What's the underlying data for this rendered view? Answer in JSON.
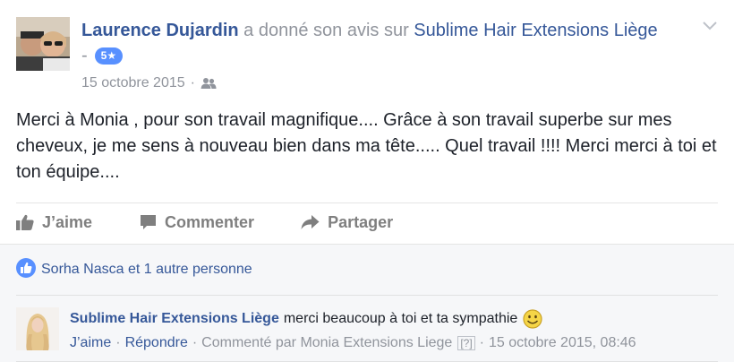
{
  "post": {
    "author": "Laurence Dujardin",
    "verb": "a donné son avis sur",
    "page": "Sublime Hair Extensions Liège",
    "dash": "-",
    "rating_badge": "5★",
    "date": "15 octobre 2015",
    "date_separator": "·",
    "audience_icon": "friends-icon",
    "text": "Merci à Monia , pour son travail magnifique.... Grâce à son travail superbe sur mes cheveux, je me sens à nouveau bien dans ma tête..... Quel travail !!!! Merci merci à toi et ton équipe...."
  },
  "actions": {
    "like": "J’aime",
    "comment": "Commenter",
    "share": "Partager"
  },
  "likes_summary": "Sorha Nasca et 1 autre personne",
  "comment": {
    "author": "Sublime Hair Extensions Liège",
    "text": "merci beaucoup à toi et ta sympathie",
    "like_link": "J’aime",
    "reply_link": "Répondre",
    "commented_by": "Commenté par Monia Extensions Liege",
    "help": "[?]",
    "timestamp": "15 octobre 2015, 08:46",
    "separator": "·"
  },
  "colors": {
    "link": "#365899",
    "muted": "#90949c",
    "badge": "#5890ff",
    "panel": "#f6f7f9"
  }
}
